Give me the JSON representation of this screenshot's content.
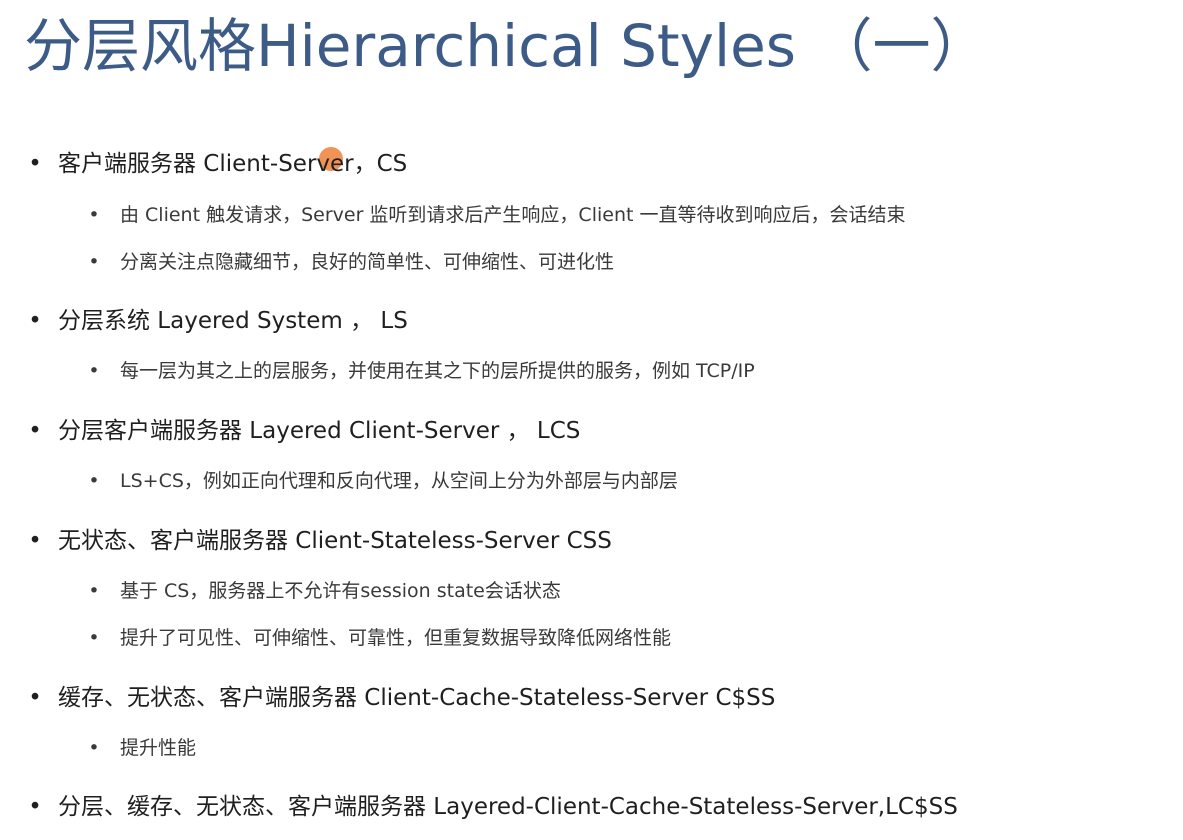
{
  "title": "分层风格Hierarchical Styles （一）",
  "bullet_symbol": "•",
  "items": [
    {
      "text": "客户端服务器 Client-Server，CS",
      "subitems": [
        "由 Client 触发请求，Server 监听到请求后产生响应，Client 一直等待收到响应后，会话结束",
        "分离关注点隐藏细节，良好的简单性、可伸缩性、可进化性"
      ]
    },
    {
      "text": "分层系统 Layered System ， LS",
      "subitems": [
        "每一层为其之上的层服务，并使用在其之下的层所提供的服务，例如 TCP/IP"
      ]
    },
    {
      "text": "分层客户端服务器 Layered Client-Server ， LCS",
      "subitems": [
        "LS+CS，例如正向代理和反向代理，从空间上分为外部层与内部层"
      ]
    },
    {
      "text": "无状态、客户端服务器 Client-Stateless-Server CSS",
      "subitems": [
        "基于 CS，服务器上不允许有session state会话状态",
        "提升了可见性、可伸缩性、可靠性，但重复数据导致降低网络性能"
      ]
    },
    {
      "text": "缓存、无状态、客户端服务器 Client-Cache-Stateless-Server C$SS",
      "subitems": [
        "提升性能"
      ]
    },
    {
      "text": "分层、缓存、无状态、客户端服务器 Layered-Client-Cache-Stateless-Server,LC$SS",
      "subitems": []
    }
  ],
  "colors": {
    "title": "#3d5b87",
    "body_text": "#1f1f1f",
    "sub_text": "#3a3a3a",
    "cursor_highlight": "#ef8d4c",
    "background": "#ffffff"
  }
}
